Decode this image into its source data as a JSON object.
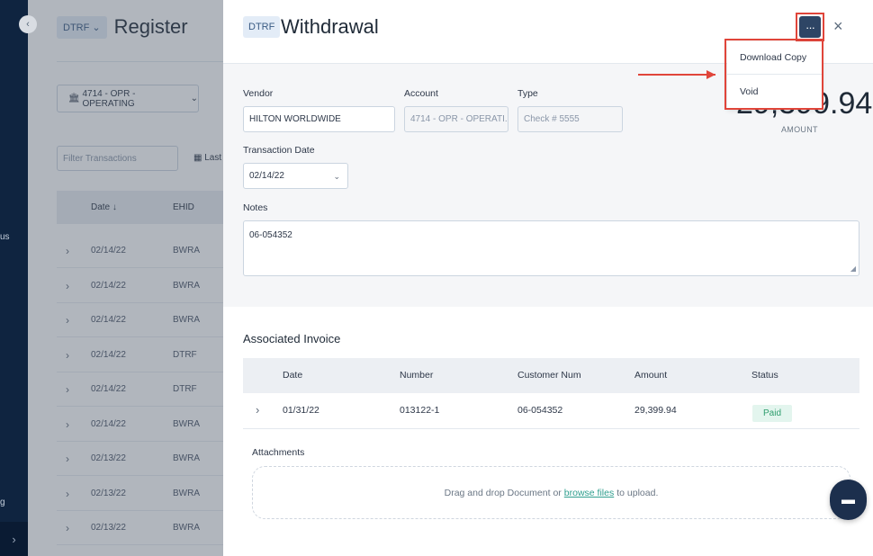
{
  "sidebar": {
    "collapse_icon": "chevron-left-icon",
    "text_1": "us",
    "text_2": "g",
    "bottom_icon": "chevron-right-icon"
  },
  "register": {
    "badge": "DTRF",
    "title": "Register",
    "account": "4714 - OPR - OPERATING",
    "filter_placeholder": "Filter Transactions",
    "last_label": "Last",
    "columns": {
      "date": "Date",
      "ehid": "EHID"
    },
    "rows": [
      {
        "date": "02/14/22",
        "ehid": "BWRA"
      },
      {
        "date": "02/14/22",
        "ehid": "BWRA"
      },
      {
        "date": "02/14/22",
        "ehid": "BWRA"
      },
      {
        "date": "02/14/22",
        "ehid": "DTRF"
      },
      {
        "date": "02/14/22",
        "ehid": "DTRF"
      },
      {
        "date": "02/14/22",
        "ehid": "BWRA"
      },
      {
        "date": "02/13/22",
        "ehid": "BWRA"
      },
      {
        "date": "02/13/22",
        "ehid": "BWRA"
      },
      {
        "date": "02/13/22",
        "ehid": "BWRA"
      }
    ]
  },
  "panel": {
    "badge": "DTRF",
    "title": "Withdrawal",
    "more_label": "···",
    "close_label": "×",
    "vendor_label": "Vendor",
    "vendor_value": "HILTON WORLDWIDE",
    "account_label": "Account",
    "account_value": "4714 - OPR - OPERATI...",
    "type_label": "Type",
    "type_value": "Check # 5555",
    "date_label": "Transaction Date",
    "date_value": "02/14/22",
    "notes_label": "Notes",
    "notes_value": "06-054352",
    "amount_value": "29,399.94",
    "amount_label": "AMOUNT",
    "menu": {
      "download": "Download Copy",
      "void": "Void"
    },
    "invoice": {
      "title": "Associated Invoice",
      "columns": [
        "Date",
        "Number",
        "Customer Num",
        "Amount",
        "Status"
      ],
      "row": {
        "date": "01/31/22",
        "number": "013122-1",
        "customer": "06-054352",
        "amount": "29,399.94",
        "status": "Paid"
      }
    },
    "attachments": {
      "label": "Attachments",
      "text_before": "Drag and drop Document or",
      "link": "browse files",
      "text_after": "to upload."
    }
  },
  "colors": {
    "highlight": "#e0453a",
    "sidebar": "#0f2440",
    "paid_text": "#2f9e6e"
  }
}
